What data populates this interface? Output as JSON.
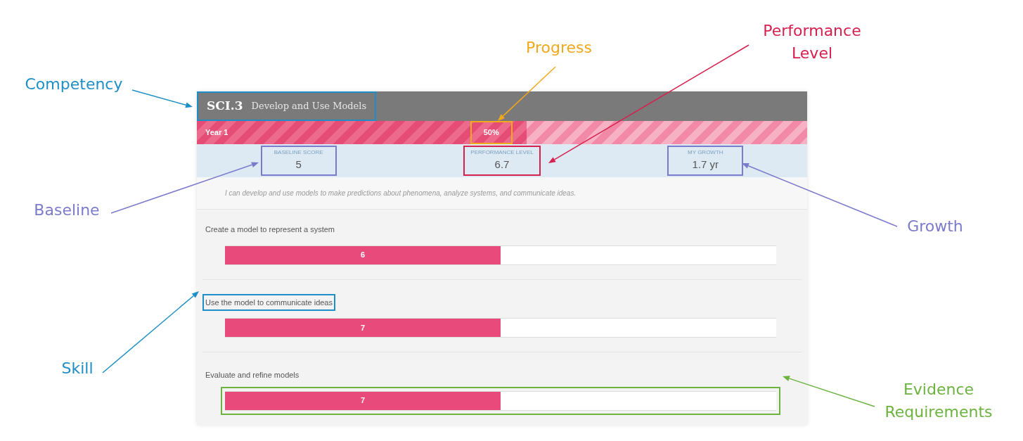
{
  "competency": {
    "code": "SCI.3",
    "title": "Develop and Use Models"
  },
  "progress": {
    "label": "Year 1",
    "value": "50%",
    "level": 0.54
  },
  "stats": [
    {
      "label": "BASELINE SCORE",
      "value": "5"
    },
    {
      "label": "PERFORMANCE LEVEL",
      "value": "6.7"
    },
    {
      "label": "MY GROWTH",
      "value": "1.7 yr"
    }
  ],
  "description": "I can develop and use models to make predictions about phenomena, analyze systems, and communicate ideas.",
  "skills": [
    {
      "label": "Create a model to represent a system",
      "value": "6",
      "level": 0.5
    },
    {
      "label": "Use the model to communicate ideas",
      "value": "7",
      "level": 0.5
    },
    {
      "label": "Evaluate and refine models",
      "value": "7",
      "level": 0.5
    }
  ],
  "annotations": [
    {
      "kind": "competency",
      "label": "Competency",
      "color": "#1e8fc6"
    },
    {
      "kind": "progress",
      "label": "Progress",
      "color": "#f0a81c"
    },
    {
      "kind": "performance",
      "label": "Performance Level",
      "color": "#d6204e"
    },
    {
      "kind": "baseline",
      "label": "Baseline",
      "color": "#7b7bcc"
    },
    {
      "kind": "growth",
      "label": "Growth",
      "color": "#7b7bcc"
    },
    {
      "kind": "skill",
      "label": "Skill",
      "color": "#1e8fc6"
    },
    {
      "kind": "evidence",
      "label": "Evidence Requirements",
      "color": "#6cb33f"
    }
  ]
}
